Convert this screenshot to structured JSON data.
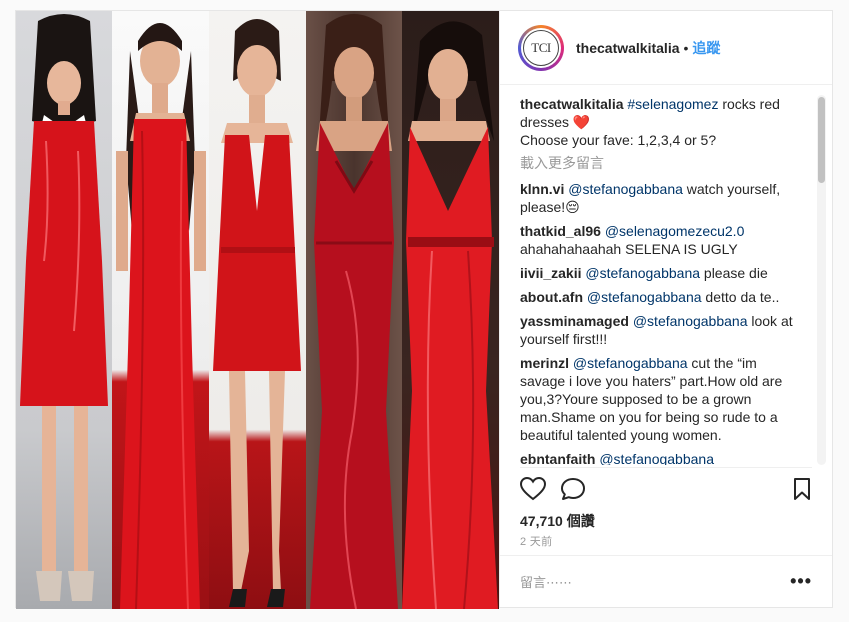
{
  "post": {
    "username": "thecatwalkitalia",
    "avatar_text": "TCI",
    "follow_label": "追蹤",
    "separator": "•",
    "caption_user": "thecatwalkitalia",
    "caption_tag": "#selenagomez",
    "caption_text": " rocks red dresses ❤️",
    "caption_line2": "Choose your fave: 1,2,3,4 or 5?",
    "load_more": "載入更多留言",
    "likes": "47,710 個讚",
    "time": "2 天前",
    "comment_placeholder": "留言⋯⋯",
    "more_options": "•••"
  },
  "comments": [
    {
      "user": "klnn.vi",
      "mention": "@stefanogabbana",
      "text": " watch yourself, please!😔"
    },
    {
      "user": "thatkid_al96",
      "mention": "@selenagomezecu2.0",
      "text": " ahahahahaahah SELENA IS UGLY"
    },
    {
      "user": "iivii_zakii",
      "mention": "@stefanogabbana",
      "text": " please die"
    },
    {
      "user": "about.afn",
      "mention": "@stefanogabbana",
      "text": " detto da te.."
    },
    {
      "user": "yassminamaged",
      "mention": "@stefanogabbana",
      "text": " look at yourself first!!!"
    },
    {
      "user": "merinzl",
      "mention": "@stefanogabbana",
      "text": " cut the “im savage i love you haters” part.How old are you,3?Youre supposed to be a grown man.Shame on you for being so rude to a beautiful talented young women."
    },
    {
      "user": "ebntanfaith",
      "mention": "@stefanogabbana",
      "text": ""
    }
  ],
  "photo": {
    "panels": [
      {
        "bg": "#cfd0d3",
        "floor": "#9fa1a5",
        "dress": "#d6131b",
        "style": "patent-mini"
      },
      {
        "bg": "#f2f2f2",
        "floor": "#c0151b",
        "dress": "#dc141c",
        "style": "long-gown"
      },
      {
        "bg": "#f1f0ee",
        "floor": "#b11217",
        "dress": "#d11419",
        "style": "satin-mini"
      },
      {
        "bg": "#5a4038",
        "floor": "#7d1a1c",
        "dress": "#b60f1e",
        "style": "halter-gown"
      },
      {
        "bg": "#2a1c1a",
        "floor": "#5a1210",
        "dress": "#e01b22",
        "style": "flowing-gown"
      }
    ],
    "icons": [
      "heart-icon",
      "comment-icon",
      "bookmark-icon"
    ]
  }
}
